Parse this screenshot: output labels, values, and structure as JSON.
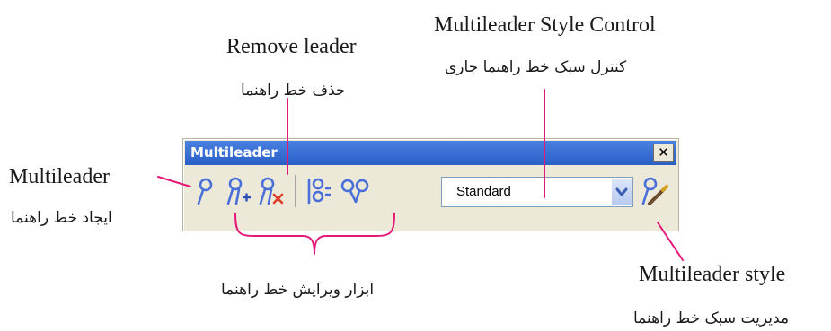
{
  "toolbar": {
    "title": "Multileader",
    "close_glyph": "✕",
    "style_select_value": "Standard",
    "icons": [
      "multileader-icon",
      "add-leader-icon",
      "remove-leader-icon",
      "align-leaders-icon",
      "collect-leaders-icon",
      "dropdown-arrow-icon",
      "multileader-style-icon"
    ]
  },
  "annotations": {
    "multileader_en": "Multileader",
    "multileader_fa": "ایجاد خط راهنما",
    "remove_leader_en": "Remove leader",
    "remove_leader_fa": "حذف خط راهنما",
    "style_control_en": "Multileader Style Control",
    "style_control_fa": "کنترل سبک خط راهنما جاری",
    "edit_tools_fa": "ابزار ویرایش خط راهنما",
    "style_en": "Multileader style",
    "style_fa": "مدیریت سبک خط راهنما"
  },
  "colors": {
    "leader_line": "#e5197a",
    "title_bar": "#2a5fc8",
    "toolbar_bg": "#ece9d8",
    "icon_blue": "#4a6fd8",
    "remove_red": "#e03a2a"
  }
}
